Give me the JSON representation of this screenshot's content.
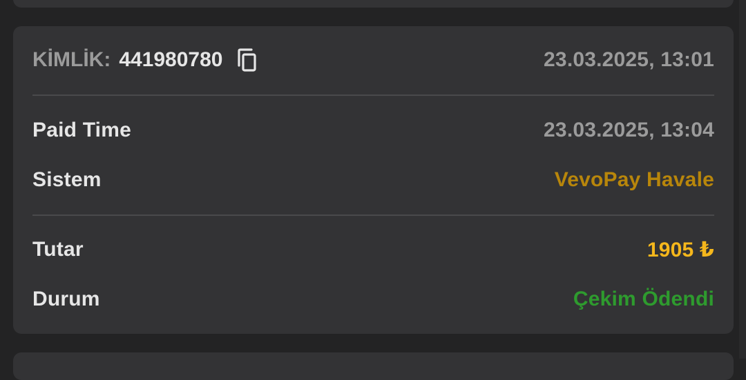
{
  "transaction": {
    "id_label": "KİMLİK:",
    "id_value": "441980780",
    "created_time": "23.03.2025, 13:01",
    "rows": [
      {
        "label": "Paid Time",
        "value": "23.03.2025, 13:04"
      },
      {
        "label": "Sistem",
        "value": "VevoPay Havale"
      },
      {
        "label": "Tutar",
        "value": "1905 ₺"
      },
      {
        "label": "Durum",
        "value": "Çekim Ödendi"
      }
    ]
  },
  "colors": {
    "background": "#232324",
    "card": "#333335",
    "label": "#e6e6e6",
    "muted": "#9b9b9b",
    "system": "#b8860b",
    "amount": "#f5b71c",
    "status_paid": "#2e9b2e",
    "divider": "#4a4a4c"
  },
  "icons": {
    "copy": "copy-icon"
  }
}
